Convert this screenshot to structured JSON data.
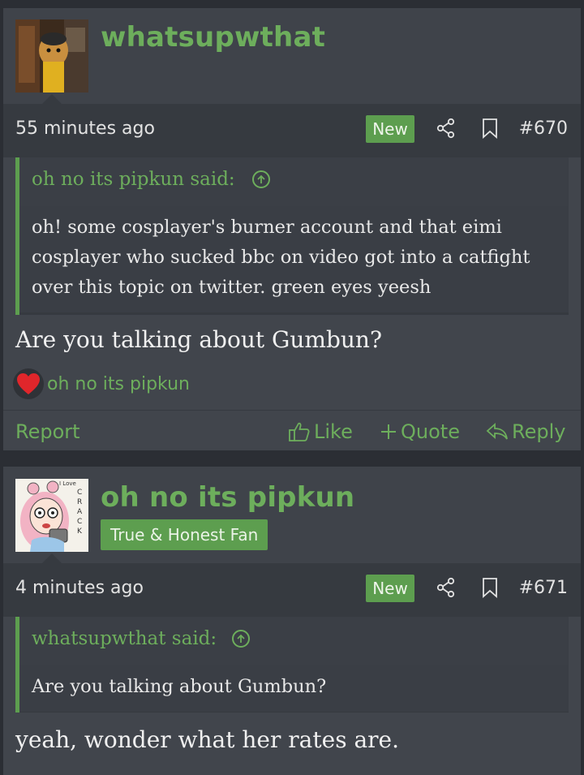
{
  "posts": [
    {
      "username": "whatsupwthat",
      "user_title": "",
      "time": "55 minutes ago",
      "new_label": "New",
      "post_number": "#670",
      "quote": {
        "attribution": "oh no its pipkun said:",
        "text": "oh! some cosplayer's burner account and that eimi cosplayer who sucked bbc on video got into a catfight over this topic on twitter. green eyes yeesh"
      },
      "body": "Are you talking about Gumbun?",
      "reactions": {
        "icon": "heart-icon",
        "by": "oh no its pipkun"
      },
      "actions": {
        "report": "Report",
        "like": "Like",
        "quote": "Quote",
        "reply": "Reply"
      }
    },
    {
      "username": "oh no its pipkun",
      "user_title": "True & Honest Fan",
      "time": "4 minutes ago",
      "new_label": "New",
      "post_number": "#671",
      "quote": {
        "attribution": "whatsupwthat said:",
        "text": "Are you talking about Gumbun?"
      },
      "body": "yeah, wonder what her rates are.",
      "avatar_text": [
        "I Love",
        "C",
        "R",
        "A",
        "C",
        "K"
      ]
    }
  ],
  "colors": {
    "accent": "#6dae5c",
    "badge": "#5d9e4f",
    "background": "#2b2e34",
    "post": "#41454c",
    "heart": "#e0262b"
  }
}
